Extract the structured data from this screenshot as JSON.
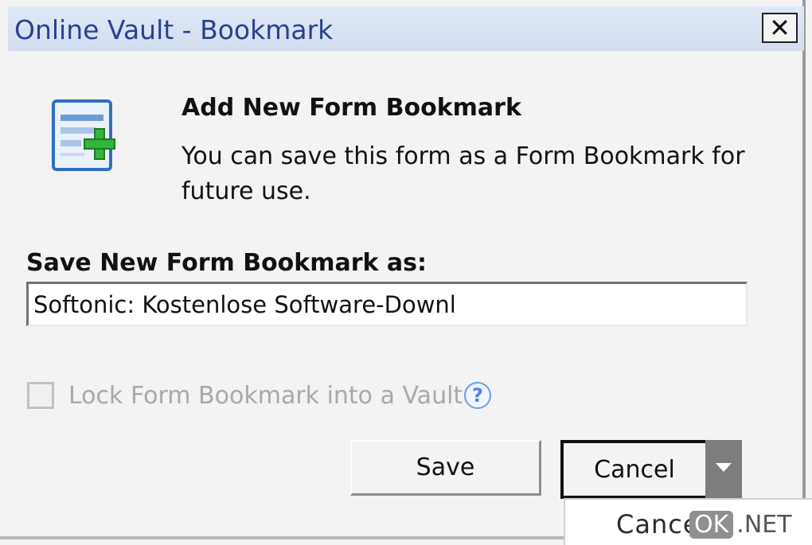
{
  "window": {
    "title": "Online Vault - Bookmark",
    "close_glyph": "✕"
  },
  "header": {
    "icon": "form-add-icon",
    "heading": "Add New Form Bookmark",
    "description": "You can save this form as a Form Bookmark for future use."
  },
  "form": {
    "label": "Save New Form Bookmark as:",
    "value": "Softonic: Kostenlose Software-Downl"
  },
  "lock_option": {
    "label": "Lock Form Bookmark into a Vault",
    "checked": false,
    "enabled": false,
    "help_glyph": "?"
  },
  "buttons": {
    "save": "Save",
    "cancel": "Cancel"
  },
  "dropdown_menu": {
    "items": [
      "Cancel"
    ]
  },
  "watermark": {
    "ok": "OK",
    "suffix": ".NET"
  },
  "colors": {
    "title_text": "#2a3f8f",
    "titlebar_bg": "#d9e3f4",
    "disabled_text": "#a8a8a8",
    "help_blue": "#4f86d8"
  }
}
